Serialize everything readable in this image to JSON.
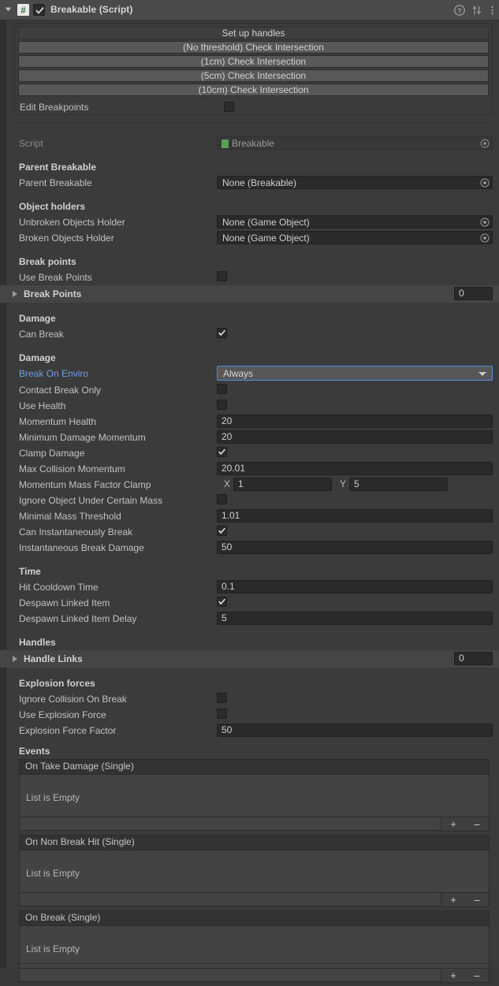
{
  "header": {
    "title": "Breakable (Script)",
    "enabled_checkbox": true,
    "script_icon_glyph": "#",
    "help_icon": "help-icon",
    "preset_icon": "preset-icon",
    "menu_icon": "kebab-menu-icon"
  },
  "custom_buttons": [
    {
      "label": "Set up handles",
      "style": "dark"
    },
    {
      "label": "(No threshold) Check Intersection",
      "style": "light"
    },
    {
      "label": "(1cm)  Check Intersection",
      "style": "light"
    },
    {
      "label": "(5cm)  Check Intersection",
      "style": "light"
    },
    {
      "label": "(10cm) Check Intersection",
      "style": "light"
    }
  ],
  "edit_breakpoints": {
    "label": "Edit Breakpoints",
    "value": false
  },
  "script_row": {
    "label": "Script",
    "value": "Breakable"
  },
  "sections": {
    "parent_breakable": {
      "header": "Parent Breakable",
      "field_label": "Parent Breakable",
      "field_value": "None (Breakable)"
    },
    "object_holders": {
      "header": "Object holders",
      "unbroken_label": "Unbroken Objects Holder",
      "unbroken_value": "None (Game Object)",
      "broken_label": "Broken Objects Holder",
      "broken_value": "None (Game Object)"
    },
    "break_points": {
      "header": "Break points",
      "use_label": "Use Break Points",
      "use_value": false,
      "array_label": "Break Points",
      "array_count": "0"
    },
    "damage_toggle": {
      "header": "Damage",
      "can_break_label": "Can Break",
      "can_break_value": true
    },
    "damage": {
      "header": "Damage",
      "break_on_enviro_label": "Break On Enviro",
      "break_on_enviro_value": "Always",
      "contact_break_only_label": "Contact Break Only",
      "contact_break_only_value": false,
      "use_health_label": "Use Health",
      "use_health_value": false,
      "momentum_health_label": "Momentum Health",
      "momentum_health_value": "20",
      "minimum_damage_momentum_label": "Minimum Damage Momentum",
      "minimum_damage_momentum_value": "20",
      "clamp_damage_label": "Clamp Damage",
      "clamp_damage_value": true,
      "max_collision_momentum_label": "Max Collision Momentum",
      "max_collision_momentum_value": "20.01",
      "momentum_mass_factor_clamp_label": "Momentum Mass Factor Clamp",
      "momentum_mass_factor_clamp_x_axis": "X",
      "momentum_mass_factor_clamp_x": "1",
      "momentum_mass_factor_clamp_y_axis": "Y",
      "momentum_mass_factor_clamp_y": "5",
      "ignore_object_under_certain_mass_label": "Ignore Object Under Certain Mass",
      "ignore_object_under_certain_mass_value": false,
      "minimal_mass_threshold_label": "Minimal Mass Threshold",
      "minimal_mass_threshold_value": "1.01",
      "can_instantaneously_break_label": "Can Instantaneously Break",
      "can_instantaneously_break_value": true,
      "instantaneous_break_damage_label": "Instantaneous Break Damage",
      "instantaneous_break_damage_value": "50"
    },
    "time": {
      "header": "Time",
      "hit_cooldown_label": "Hit Cooldown Time",
      "hit_cooldown_value": "0.1",
      "despawn_linked_item_label": "Despawn Linked Item",
      "despawn_linked_item_value": true,
      "despawn_linked_item_delay_label": "Despawn Linked Item Delay",
      "despawn_linked_item_delay_value": "5"
    },
    "handles": {
      "header": "Handles",
      "array_label": "Handle Links",
      "array_count": "0"
    },
    "explosion_forces": {
      "header": "Explosion forces",
      "ignore_collision_label": "Ignore Collision On Break",
      "ignore_collision_value": false,
      "use_explosion_force_label": "Use Explosion Force",
      "use_explosion_force_value": false,
      "explosion_force_factor_label": "Explosion Force Factor",
      "explosion_force_factor_value": "50"
    },
    "events": {
      "header": "Events",
      "empty_text": "List is Empty",
      "add_label": "+",
      "remove_label": "–",
      "lists": [
        {
          "title": "On Take Damage (Single)"
        },
        {
          "title": "On Non Break Hit (Single)"
        },
        {
          "title": "On Break (Single)"
        }
      ]
    }
  },
  "colors": {
    "panel_bg": "#3b3b3b",
    "header_bg": "#4a4a4a",
    "field_bg": "#2a2a2a",
    "accent_blue": "#4f8ede",
    "link_blue": "#6f9fe8",
    "button_light": "#585858"
  }
}
